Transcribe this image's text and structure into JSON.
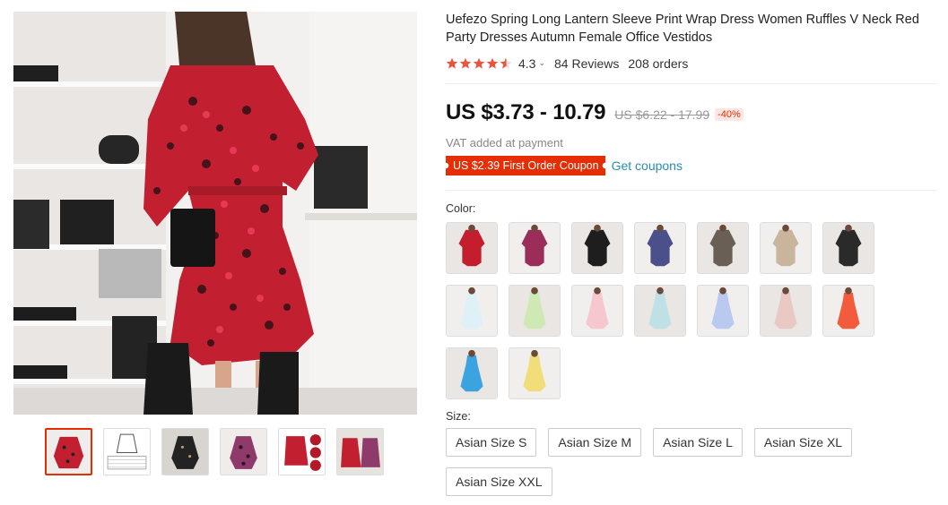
{
  "product": {
    "title": "Uefezo Spring Long Lantern Sleeve Print Wrap Dress Women Ruffles V Neck Red Party Dresses Autumn Female Office Vestidos",
    "rating": "4.3",
    "reviews": "84 Reviews",
    "orders": "208 orders",
    "price": "US $3.73 - 10.79",
    "original_price": "US $6.22 - 17.99",
    "discount": "-40%",
    "vat_note": "VAT added at payment",
    "coupon": "US $2.39 First Order Coupon",
    "get_coupons": "Get coupons",
    "color_label": "Color:",
    "size_label": "Size:",
    "sizes": [
      "Asian Size S",
      "Asian Size M",
      "Asian Size L",
      "Asian Size XL",
      "Asian Size XXL"
    ]
  },
  "colors": {
    "accent": "#e62e04",
    "link": "#2a8bb5",
    "star": "#f0513c"
  },
  "gallery": {
    "thumb_count": 6,
    "active_thumb": 1
  },
  "swatches": [
    {
      "color": "#c41e2e"
    },
    {
      "color": "#9b2d5a"
    },
    {
      "color": "#1e1e1e"
    },
    {
      "color": "#4b4f8a"
    },
    {
      "color": "#6a5f55"
    },
    {
      "color": "#c9b59c"
    },
    {
      "color": "#2a2a2a"
    },
    {
      "color": "#dff0f7"
    },
    {
      "color": "#cfe9b5"
    },
    {
      "color": "#f6c7cc"
    },
    {
      "color": "#bfe0e4"
    },
    {
      "color": "#b9c9f0"
    },
    {
      "color": "#e8c9c4"
    },
    {
      "color": "#f25c3c"
    },
    {
      "color": "#3aa3e0"
    },
    {
      "color": "#f2dd7b"
    }
  ]
}
